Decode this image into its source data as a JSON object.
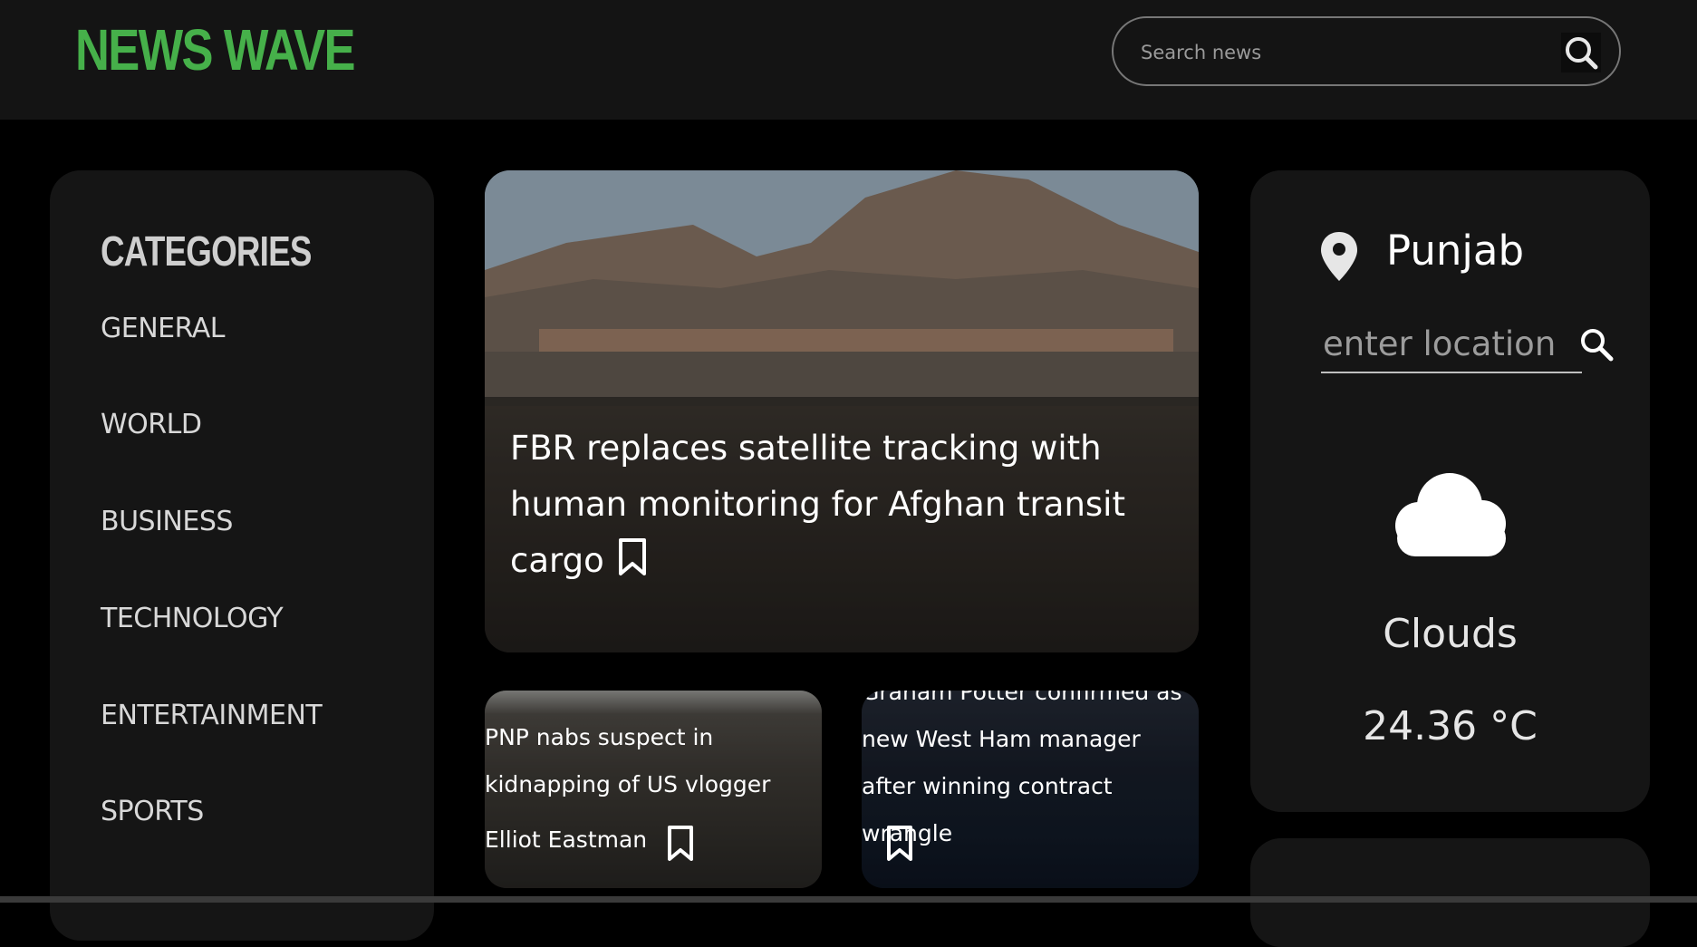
{
  "header": {
    "logo": "NEWS WAVE",
    "search_placeholder": "Search news",
    "search_icon": "search-icon"
  },
  "sidebar": {
    "title": "CATEGORIES",
    "items": [
      "GENERAL",
      "WORLD",
      "BUSINESS",
      "TECHNOLOGY",
      "ENTERTAINMENT",
      "SPORTS"
    ]
  },
  "hero": {
    "title": "FBR replaces satellite tracking with human monitoring for Afghan transit cargo",
    "bookmark_icon": "bookmark-icon"
  },
  "cards": [
    {
      "title": "PNP nabs suspect in kidnapping of US vlogger",
      "author": "Elliot Eastman",
      "bookmark_icon": "bookmark-icon"
    },
    {
      "title": "Graham Potter confirmed as new West Ham manager after winning contract wrangle",
      "bookmark_icon": "bookmark-icon"
    }
  ],
  "weather": {
    "location": "Punjab",
    "location_placeholder": "enter location",
    "condition": "Clouds",
    "temperature": "24.36 °C",
    "pin_icon": "location-pin-icon",
    "condition_icon": "cloud-icon",
    "search_icon": "search-icon"
  },
  "colors": {
    "brand": "#46b04a",
    "background": "#000000",
    "panel": "#151515",
    "header": "#141414"
  }
}
